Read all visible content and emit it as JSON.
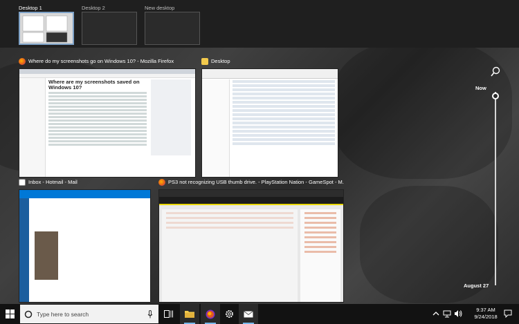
{
  "desktops": [
    {
      "label": "Desktop 1",
      "active": true
    },
    {
      "label": "Desktop 2",
      "active": false
    },
    {
      "label": "New desktop",
      "active": false
    }
  ],
  "windows": {
    "firefox": {
      "title": "Where do my screenshots go on Windows 10? - Mozilla Firefox",
      "heading": "Where are my screenshots saved on Windows 10?"
    },
    "explorer": {
      "title": "Desktop"
    },
    "mail": {
      "title": "Inbox - Hotmail - Mail"
    },
    "gamespot": {
      "title": "PS3 not recognizing USB thumb drive. - PlayStation Nation - GameSpot - M..."
    }
  },
  "timeline": {
    "now_label": "Now",
    "earlier_label": "August 27"
  },
  "taskbar": {
    "search_placeholder": "Type here to search"
  },
  "clock": {
    "time": "9:37 AM",
    "date": "9/24/2018"
  },
  "colors": {
    "accent": "#76b9ed",
    "active_desktop_border": "#7ea2c7",
    "taskbar": "#121212"
  },
  "icons": [
    "windows-start-icon",
    "search-icon",
    "microphone-icon",
    "task-view-icon",
    "file-explorer-icon",
    "firefox-icon",
    "settings-icon",
    "mail-icon",
    "chevron-up-icon",
    "network-icon",
    "volume-icon",
    "notification-icon"
  ]
}
